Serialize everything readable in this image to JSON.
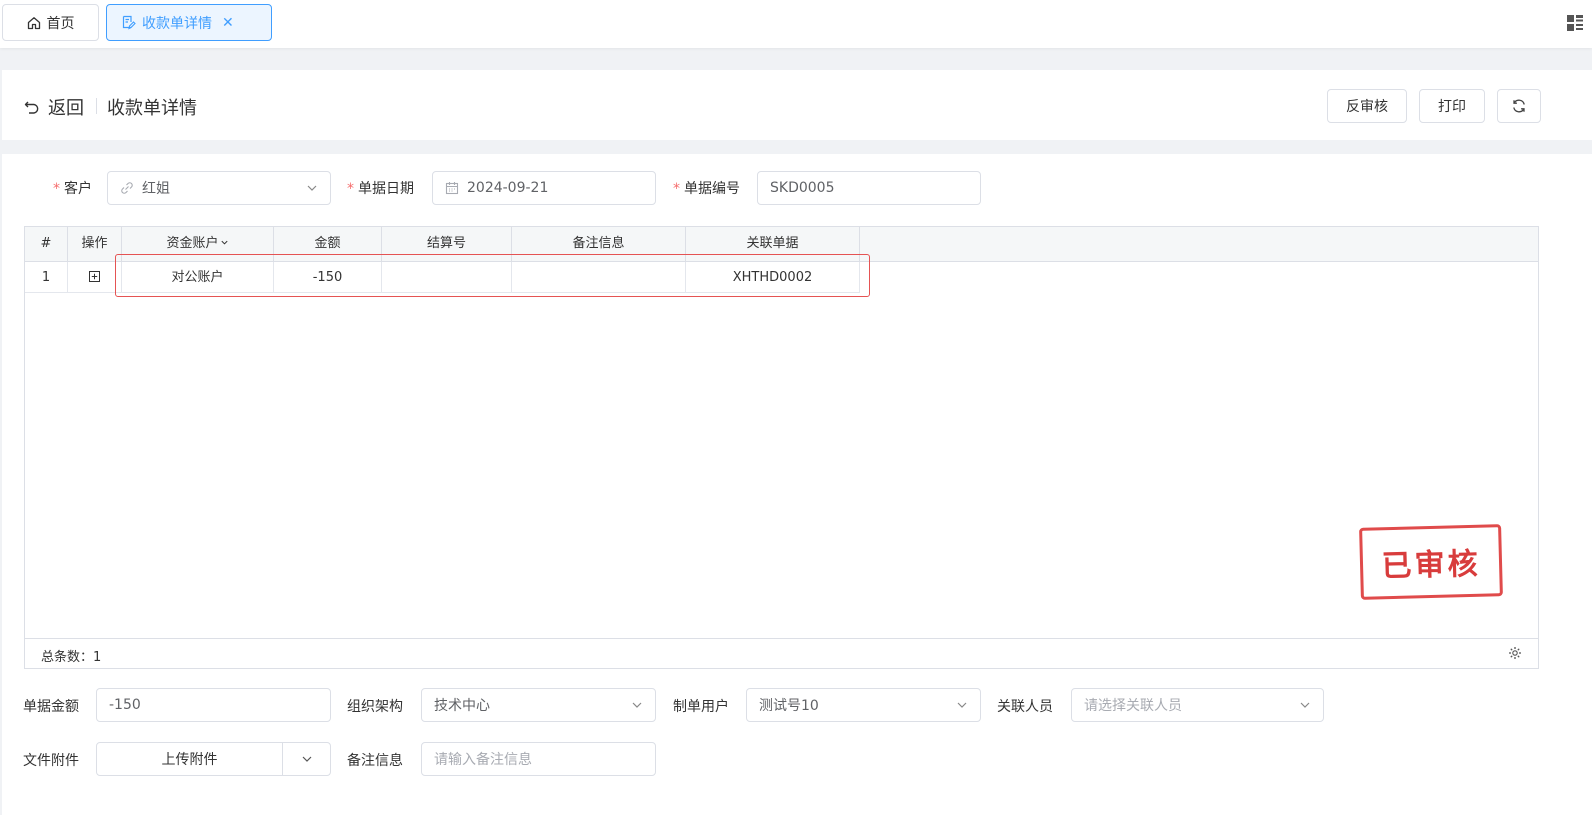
{
  "tabs": {
    "home_label": "首页",
    "active_label": "收款单详情"
  },
  "header": {
    "back_label": "返回",
    "title": "收款单详情",
    "unaudit_label": "反审核",
    "print_label": "打印"
  },
  "form": {
    "customer_label": "客户",
    "customer_value": "红姐",
    "date_label": "单据日期",
    "date_value": "2024-09-21",
    "code_label": "单据编号",
    "code_value": "SKD0005",
    "amount_label": "单据金额",
    "amount_value": "-150",
    "org_label": "组织架构",
    "org_value": "技术中心",
    "creator_label": "制单用户",
    "creator_value": "测试号10",
    "related_label": "关联人员",
    "related_placeholder": "请选择关联人员",
    "attach_label": "文件附件",
    "attach_button": "上传附件",
    "note_label": "备注信息",
    "note_placeholder": "请输入备注信息"
  },
  "table": {
    "columns": [
      "#",
      "操作",
      "资金账户",
      "金额",
      "结算号",
      "备注信息",
      "关联单据"
    ],
    "rows": [
      {
        "index": "1",
        "account": "对公账户",
        "amount": "-150",
        "settle_no": "",
        "note": "",
        "related_doc": "XHTHD0002"
      }
    ],
    "total_text": "总条数：1"
  },
  "stamp_text": "已审核",
  "colors": {
    "accent": "#409eff",
    "required": "#f56c6c",
    "stamp": "#d83c3c"
  }
}
